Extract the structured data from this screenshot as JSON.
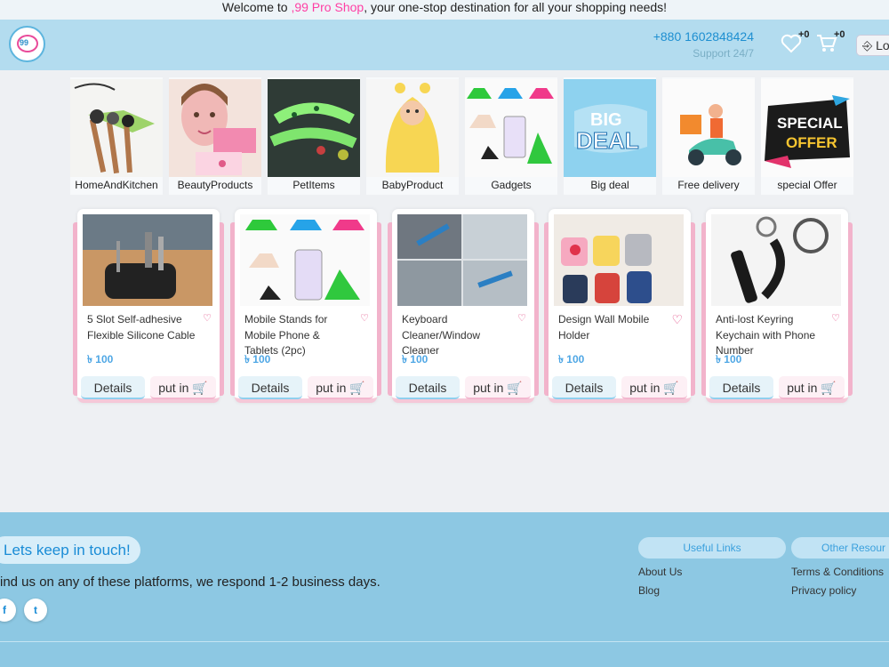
{
  "topbar": {
    "prefix": "Welcome to ",
    "brand": ",99 Pro Shop",
    "suffix": ", your one-stop destination for all your shopping needs!"
  },
  "header": {
    "logo_text": "99",
    "phone": "+880 1602848424",
    "support": "Support 24/7",
    "wishlist_count": "+0",
    "cart_count": "+0",
    "login_label": "Lo"
  },
  "categories": [
    {
      "label": "HomeAndKitchen"
    },
    {
      "label": "BeautyProducts"
    },
    {
      "label": "PetItems"
    },
    {
      "label": "BabyProduct"
    },
    {
      "label": "Gadgets"
    },
    {
      "label": "Big deal",
      "art_line1": "BIG",
      "art_line2": "DEAL"
    },
    {
      "label": "Free delivery"
    },
    {
      "label": "special Offer",
      "art_line1": "SPECIAL",
      "art_line2": "OFFER"
    }
  ],
  "products": [
    {
      "title": "5 Slot Self-adhesive Flexible Silicone Cable",
      "price": "৳ 100",
      "details_label": "Details",
      "put_label": "put in 🛒"
    },
    {
      "title": "Mobile Stands for Mobile Phone & Tablets (2pc)",
      "price": "৳ 100",
      "details_label": "Details",
      "put_label": "put in 🛒"
    },
    {
      "title": "Keyboard Cleaner/Window Cleaner",
      "price": "৳ 100",
      "details_label": "Details",
      "put_label": "put in 🛒"
    },
    {
      "title": "Design Wall Mobile Holder",
      "price": "৳ 100",
      "details_label": "Details",
      "put_label": "put in 🛒"
    },
    {
      "title": "Anti-lost Keyring Keychain with Phone Number",
      "price": "৳ 100",
      "details_label": "Details",
      "put_label": "put in 🛒"
    }
  ],
  "footer": {
    "touch_label": "Lets keep in touch!",
    "find_text": "ind us on any of these platforms, we respond 1-2 business days.",
    "useful_links_title": "Useful Links",
    "other_resources_title": "Other Resour",
    "useful_links": [
      "About Us",
      "Blog"
    ],
    "other_links": [
      "Terms & Conditions",
      "Privacy policy"
    ]
  },
  "colors": {
    "header_bg": "#b3dcef",
    "footer_bg": "#8dc8e3",
    "accent_pink": "#ff3fa4",
    "accent_blue": "#1e8fd1"
  }
}
